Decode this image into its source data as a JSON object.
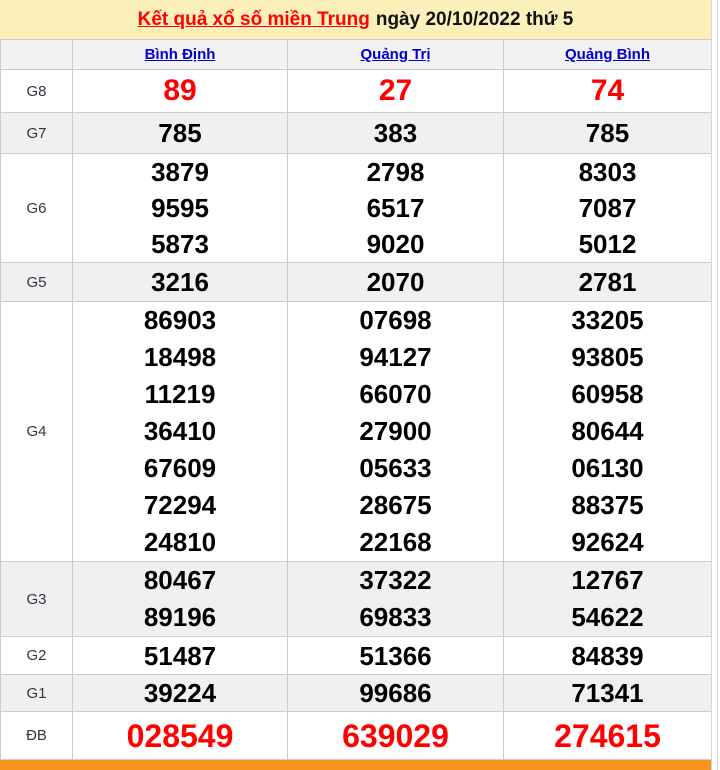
{
  "header": {
    "title_link": "Kết quả xổ số miền Trung",
    "title_rest": "ngày 20/10/2022 thứ 5"
  },
  "table": {
    "columns": [
      "Bình Định",
      "Quảng Trị",
      "Quảng Bình"
    ],
    "rows": [
      {
        "label": "G8",
        "cells": [
          [
            "89"
          ],
          [
            "27"
          ],
          [
            "74"
          ]
        ]
      },
      {
        "label": "G7",
        "cells": [
          [
            "785"
          ],
          [
            "383"
          ],
          [
            "785"
          ]
        ]
      },
      {
        "label": "G6",
        "cells": [
          [
            "3879",
            "9595",
            "5873"
          ],
          [
            "2798",
            "6517",
            "9020"
          ],
          [
            "8303",
            "7087",
            "5012"
          ]
        ]
      },
      {
        "label": "G5",
        "cells": [
          [
            "3216"
          ],
          [
            "2070"
          ],
          [
            "2781"
          ]
        ]
      },
      {
        "label": "G4",
        "cells": [
          [
            "86903",
            "18498",
            "11219",
            "36410",
            "67609",
            "72294",
            "24810"
          ],
          [
            "07698",
            "94127",
            "66070",
            "27900",
            "05633",
            "28675",
            "22168"
          ],
          [
            "33205",
            "93805",
            "60958",
            "80644",
            "06130",
            "88375",
            "92624"
          ]
        ]
      },
      {
        "label": "G3",
        "cells": [
          [
            "80467",
            "89196"
          ],
          [
            "37322",
            "69833"
          ],
          [
            "12767",
            "54622"
          ]
        ]
      },
      {
        "label": "G2",
        "cells": [
          [
            "51487"
          ],
          [
            "51366"
          ],
          [
            "84839"
          ]
        ]
      },
      {
        "label": "G1",
        "cells": [
          [
            "39224"
          ],
          [
            "99686"
          ],
          [
            "71341"
          ]
        ]
      },
      {
        "label": "ĐB",
        "cells": [
          [
            "028549"
          ],
          [
            "639029"
          ],
          [
            "274615"
          ]
        ]
      }
    ]
  },
  "colors": {
    "band_yellow": "#fbf0b9",
    "bar_orange": "#f7941e",
    "accent_red": "#ff0000",
    "link_blue": "#0000cc",
    "alt_row_gray": "#f0f0f0",
    "border_gray": "#cccccc"
  }
}
